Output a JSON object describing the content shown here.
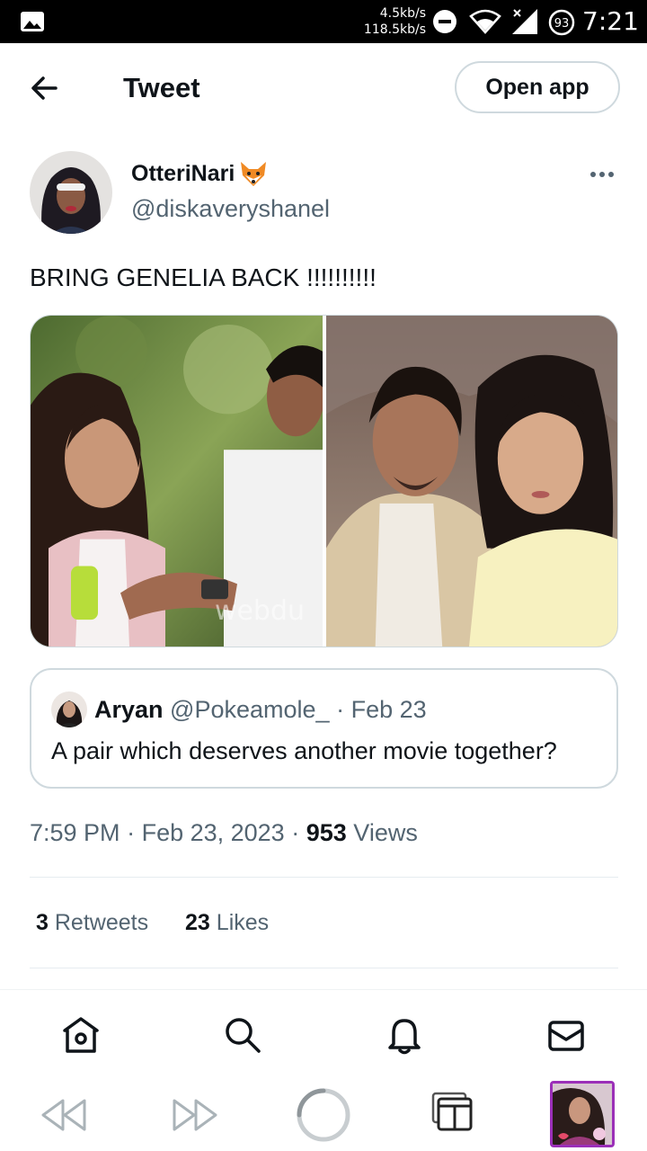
{
  "status_bar": {
    "net_up": "4.5kb/s",
    "net_down": "118.5kb/s",
    "battery": "93",
    "time": "7:21"
  },
  "header": {
    "title": "Tweet",
    "open_app": "Open app"
  },
  "tweet": {
    "author_name": "OtteriNari",
    "author_handle": "@diskaveryshanel",
    "text": "BRING GENELIA BACK !!!!!!!!!!",
    "watermark": "webdu",
    "quote": {
      "name": "Aryan",
      "handle": "@Pokeamole_",
      "date": "· Feb 23",
      "text": "A pair which deserves another movie together?"
    },
    "time": "7:59 PM",
    "date": "· Feb 23, 2023 ·",
    "views_count": "953",
    "views_label": "Views",
    "retweets_count": "3",
    "retweets_label": "Retweets",
    "likes_count": "23",
    "likes_label": "Likes"
  },
  "tabs": [
    "home-icon",
    "search-icon",
    "notifications-icon",
    "messages-icon"
  ],
  "colors": {
    "text": "#0f1419",
    "secondary": "#536471",
    "border": "#cfd9de",
    "nav_accent": "#9b2fb8"
  }
}
